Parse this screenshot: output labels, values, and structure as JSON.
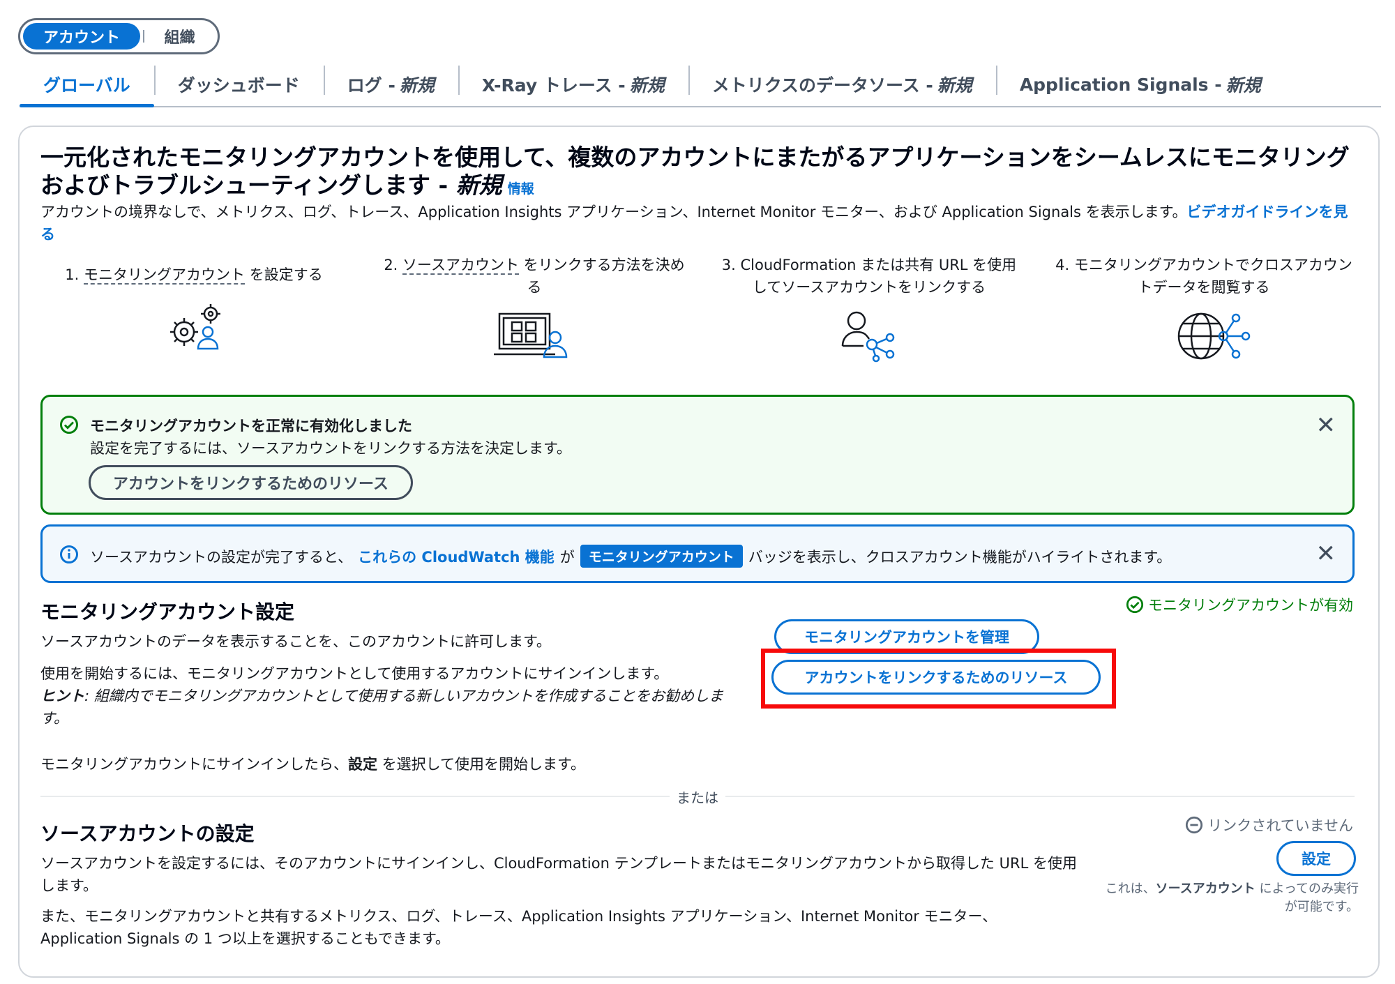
{
  "toggle": {
    "active": "アカウント",
    "inactive": "組織"
  },
  "tabs": [
    {
      "label": "グローバル",
      "new": ""
    },
    {
      "label": "ダッシュボード",
      "new": ""
    },
    {
      "label": "ログ - ",
      "new": "新規"
    },
    {
      "label": "X-Ray トレース - ",
      "new": "新規"
    },
    {
      "label": "メトリクスのデータソース - ",
      "new": "新規"
    },
    {
      "label": "Application Signals - ",
      "new": "新規"
    }
  ],
  "hero": {
    "title": "一元化されたモニタリングアカウントを使用して、複数のアカウントにまたがるアプリケーションをシームレスにモニタリングおよびトラブルシューティングします - ",
    "title_new": "新規",
    "info": "情報",
    "description": "アカウントの境界なしで、メトリクス、ログ、トレース、Application Insights アプリケーション、Internet Monitor モニター、および Application Signals を表示します。",
    "video_link": "ビデオガイドラインを見る"
  },
  "steps": [
    {
      "prefix": "1. ",
      "term": "モニタリングアカウント",
      "suffix": " を設定する",
      "icon": "gears-user-icon"
    },
    {
      "prefix": "2. ",
      "term": "ソースアカウント",
      "suffix": " をリンクする方法を決める",
      "icon": "laptop-user-icon"
    },
    {
      "prefix": "3. CloudFormation または共有 URL を使用してソースアカウントをリンクする",
      "term": "",
      "suffix": "",
      "icon": "user-network-icon"
    },
    {
      "prefix": "4. モニタリングアカウントでクロスアカウントデータを閲覧する",
      "term": "",
      "suffix": "",
      "icon": "globe-network-icon"
    }
  ],
  "success_alert": {
    "title": "モニタリングアカウントを正常に有効化しました",
    "message": "設定を完了するには、ソースアカウントをリンクする方法を決定します。",
    "button": "アカウントをリンクするためのリソース"
  },
  "info_alert": {
    "before": "ソースアカウントの設定が完了すると、",
    "link": "これらの CloudWatch 機能",
    "middle": "が",
    "badge": "モニタリングアカウント",
    "after": "バッジを表示し、クロスアカウント機能がハイライトされます。"
  },
  "monitoring": {
    "heading": "モニタリングアカウント設定",
    "status": "モニタリングアカウントが有効",
    "desc1": "ソースアカウントのデータを表示することを、このアカウントに許可します。",
    "desc2": "使用を開始するには、モニタリングアカウントとして使用するアカウントにサインインします。",
    "hint_label": "ヒント",
    "hint": ": 組織内でモニタリングアカウントとして使用する新しいアカウントを作成することをお勧めしま",
    "hint_tail": "す。",
    "desc3_before": "モニタリングアカウントにサインインしたら、",
    "desc3_bold": "設定",
    "desc3_after": " を選択して使用を開始します。",
    "manage_button": "モニタリングアカウントを管理",
    "resources_button": "アカウントをリンクするためのリソース"
  },
  "divider_label": "または",
  "source": {
    "heading": "ソースアカウントの設定",
    "status": "リンクされていません",
    "desc1": "ソースアカウントを設定するには、そのアカウントにサインインし、CloudFormation テンプレートまたはモニタリングアカウントから取得した URL を使用します。",
    "desc2": "また、モニタリングアカウントと共有するメトリクス、ログ、トレース、Application Insights アプリケーション、Internet Monitor モニター、Application Signals の 1 つ以上を選択することもできます。",
    "button": "設定",
    "note_before": "これは、",
    "note_bold": "ソースアカウント",
    "note_after": " によってのみ実行が可能です。"
  },
  "colors": {
    "accent": "#0972d3",
    "success": "#037f0c",
    "highlight": "#f70a0a"
  }
}
